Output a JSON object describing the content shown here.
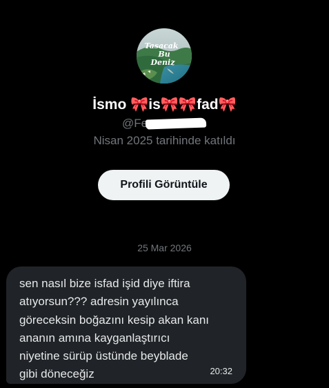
{
  "profile": {
    "avatar_text": [
      "Tasacak",
      "Bu",
      "Deniz"
    ],
    "display_name": "İsmo 🎀is🎀🎀fad🎀",
    "username": "@Fey",
    "joined": "Nisan 2025 tarihinde katıldı",
    "view_profile_label": "Profili Görüntüle"
  },
  "conversation": {
    "date_divider": "25 Mar 2026",
    "messages": [
      {
        "text": "sen nasıl bize isfad işid diye iftira\natıyorsun??? adresin yayılınca\ngöreceksin boğazını kesip akan kanı\nananın amına kayganlaştırıcı\nniyetine sürüp üstünde beyblade\ngibi döneceğiz",
        "time": "20:32"
      }
    ]
  },
  "colors": {
    "background": "#000000",
    "bubble": "#202327",
    "button_bg": "#eff3f4",
    "secondary_text": "#71767b"
  },
  "icons": {
    "avatar": "coastal-landscape-photo"
  }
}
